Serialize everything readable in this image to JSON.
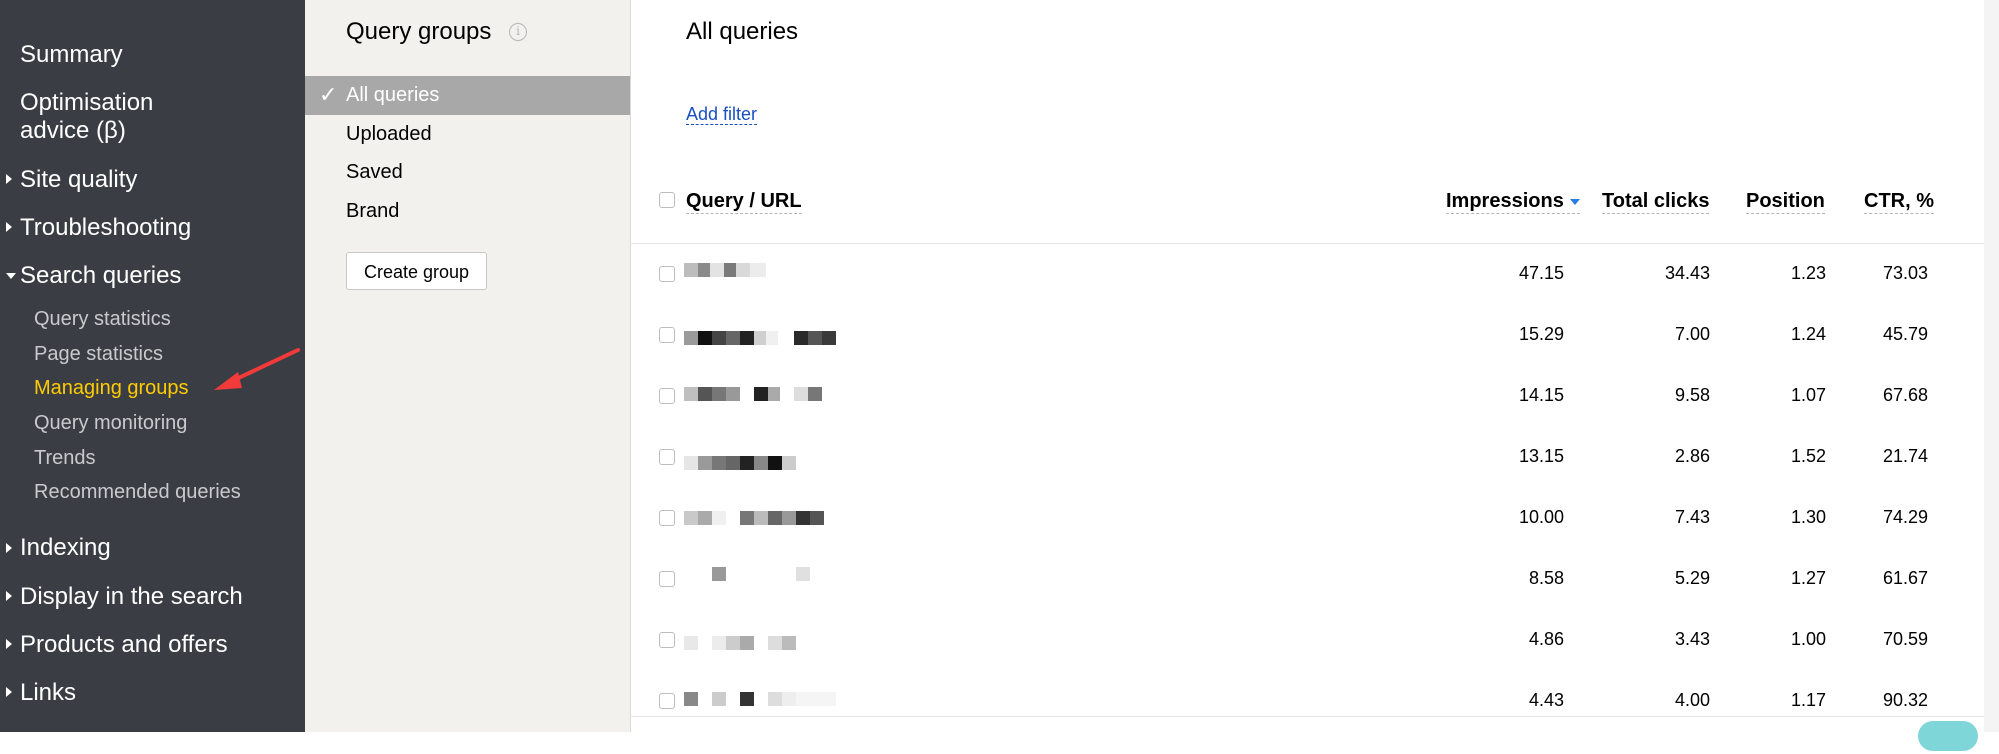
{
  "sidebar": {
    "items": [
      {
        "label": "Summary"
      },
      {
        "label": "Optimisation"
      },
      {
        "label": "advice (β)"
      },
      {
        "label": "Site quality"
      },
      {
        "label": "Troubleshooting"
      },
      {
        "label": "Search queries"
      },
      {
        "label": "Indexing"
      },
      {
        "label": "Display in the search"
      },
      {
        "label": "Products and offers"
      },
      {
        "label": "Links"
      }
    ],
    "subitems": [
      {
        "label": "Query statistics"
      },
      {
        "label": "Page statistics"
      },
      {
        "label": "Managing groups"
      },
      {
        "label": "Query monitoring"
      },
      {
        "label": "Trends"
      },
      {
        "label": "Recommended queries"
      }
    ],
    "active_color": "#ffcc00",
    "background": "#3b3d44"
  },
  "groups_panel": {
    "title": "Query groups",
    "info_icon": "i",
    "groups": [
      {
        "label": "All queries"
      },
      {
        "label": "Uploaded"
      },
      {
        "label": "Saved"
      },
      {
        "label": "Brand"
      }
    ],
    "create_button": "Create group"
  },
  "main": {
    "title": "All queries",
    "add_filter": "Add filter",
    "columns": [
      "Query / URL",
      "Impressions",
      "Total clicks",
      "Position",
      "CTR, %"
    ],
    "rows": [
      {
        "impressions": "47.15",
        "clicks": "34.43",
        "position": "1.23",
        "ctr": "73.03"
      },
      {
        "impressions": "15.29",
        "clicks": "7.00",
        "position": "1.24",
        "ctr": "45.79"
      },
      {
        "impressions": "14.15",
        "clicks": "9.58",
        "position": "1.07",
        "ctr": "67.68"
      },
      {
        "impressions": "13.15",
        "clicks": "2.86",
        "position": "1.52",
        "ctr": "21.74"
      },
      {
        "impressions": "10.00",
        "clicks": "7.43",
        "position": "1.30",
        "ctr": "74.29"
      },
      {
        "impressions": "8.58",
        "clicks": "5.29",
        "position": "1.27",
        "ctr": "61.67"
      },
      {
        "impressions": "4.86",
        "clicks": "3.43",
        "position": "1.00",
        "ctr": "70.59"
      },
      {
        "impressions": "4.43",
        "clicks": "4.00",
        "position": "1.17",
        "ctr": "90.32"
      }
    ],
    "link_color": "#1a4fc4",
    "sort_color": "#2a7de1"
  }
}
